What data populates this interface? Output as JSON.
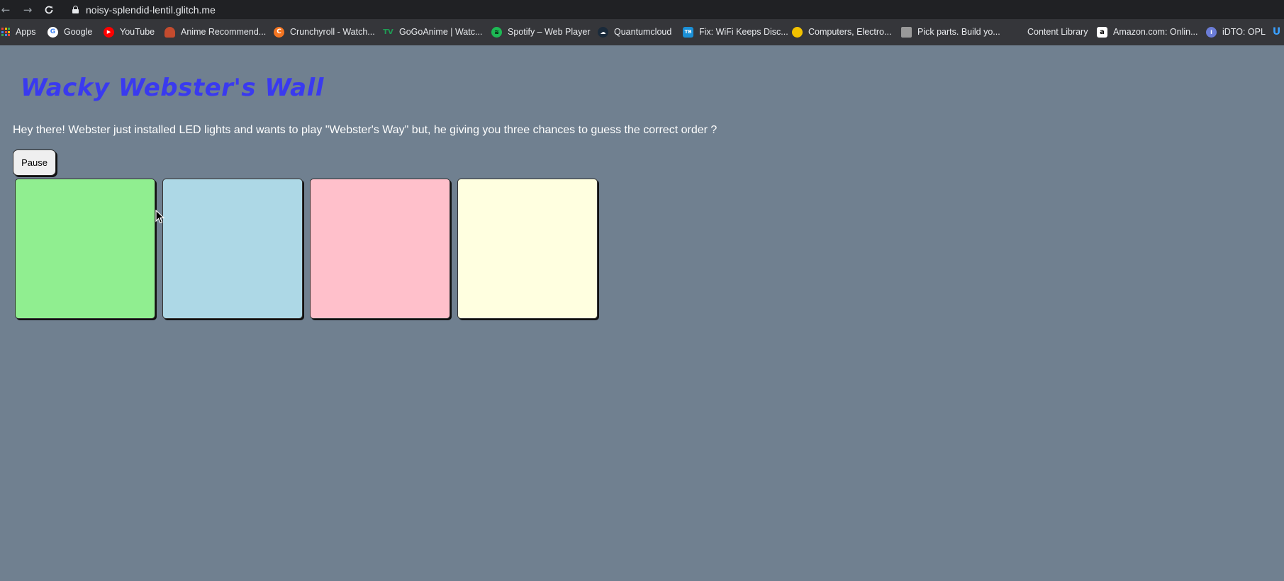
{
  "browser": {
    "url": "noisy-splendid-lentil.glitch.me",
    "bookmarks": [
      {
        "label": "Apps",
        "icon": "apps-grid-icon"
      },
      {
        "label": "Google",
        "icon": "google-icon",
        "color": "#ffffff"
      },
      {
        "label": "YouTube",
        "icon": "youtube-icon",
        "color": "#ff0000"
      },
      {
        "label": "Anime Recommend...",
        "icon": "anime-icon",
        "color": "#c44b2e"
      },
      {
        "label": "Crunchyroll - Watch...",
        "icon": "crunchyroll-icon",
        "color": "#f47521"
      },
      {
        "label": "GoGoAnime | Watc...",
        "icon": "gogoanime-icon",
        "color": "#1f9d55"
      },
      {
        "label": "Spotify – Web Player",
        "icon": "spotify-icon",
        "color": "#1db954"
      },
      {
        "label": "Quantumcloud",
        "icon": "cloud-icon",
        "color": "#1a2a3a"
      },
      {
        "label": "Fix: WiFi Keeps Disc...",
        "icon": "tb-icon",
        "color": "#1a8fd6"
      },
      {
        "label": "Computers, Electro...",
        "icon": "lemon-icon",
        "color": "#f2c200"
      },
      {
        "label": "Pick parts. Build yo...",
        "icon": "pcpartpicker-icon",
        "color": "#999999"
      },
      {
        "label": "Content Library",
        "icon": "",
        "color": ""
      },
      {
        "label": "Amazon.com: Onlin...",
        "icon": "amazon-icon",
        "color": "#ffffff"
      },
      {
        "label": "iDTO: OPL",
        "icon": "idto-icon",
        "color": "#6b7cd6"
      }
    ]
  },
  "page": {
    "title": "Wacky Webster's Wall",
    "intro": "Hey there! Webster just installed LED lights and wants to play \"Webster's Way\" but, he giving you three chances to guess the correct order ?",
    "pause_label": "Pause"
  },
  "tiles": [
    {
      "color": "#90ee90"
    },
    {
      "color": "#add8e6"
    },
    {
      "color": "#ffc0cb"
    },
    {
      "color": "#ffffe0"
    }
  ],
  "colors": {
    "background": "#708090",
    "title": "#3a3aef"
  }
}
